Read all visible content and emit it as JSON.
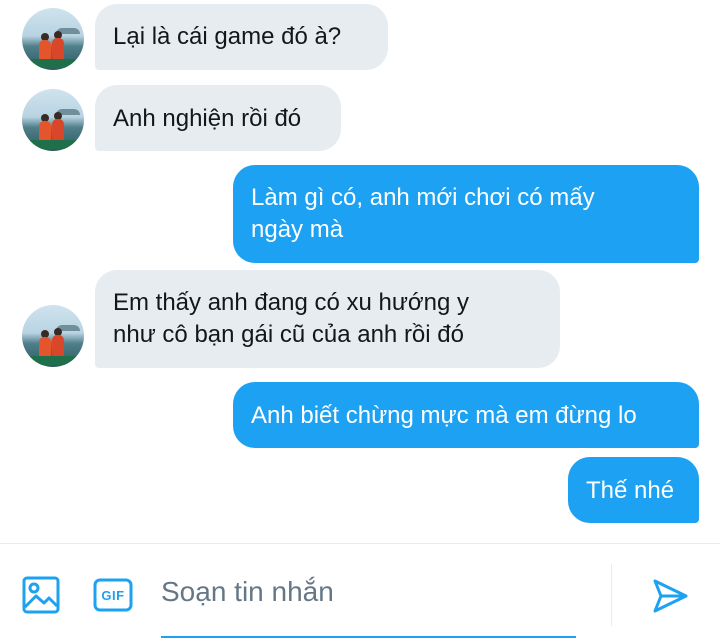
{
  "conversation": {
    "messages": [
      {
        "text": "Lại là cái game đó à?"
      },
      {
        "text": "Anh nghiện rồi đó"
      },
      {
        "text": "Làm gì có, anh mới chơi có mấy\nngày mà"
      },
      {
        "text": "Em thấy anh đang có xu hướng y\nnhư cô bạn gái cũ của anh rồi đó"
      },
      {
        "text": "Anh biết chừng mực mà em đừng lo"
      },
      {
        "text": "Thế nhé"
      }
    ]
  },
  "composer": {
    "placeholder": "Soạn tin nhắn",
    "gif_label": "GIF"
  },
  "colors": {
    "accent": "#1da1f2",
    "received_bubble": "#e6ecf0",
    "received_text": "#14171a",
    "placeholder_text": "#657786"
  },
  "icons": [
    "image-icon",
    "gif-icon",
    "send-icon"
  ]
}
